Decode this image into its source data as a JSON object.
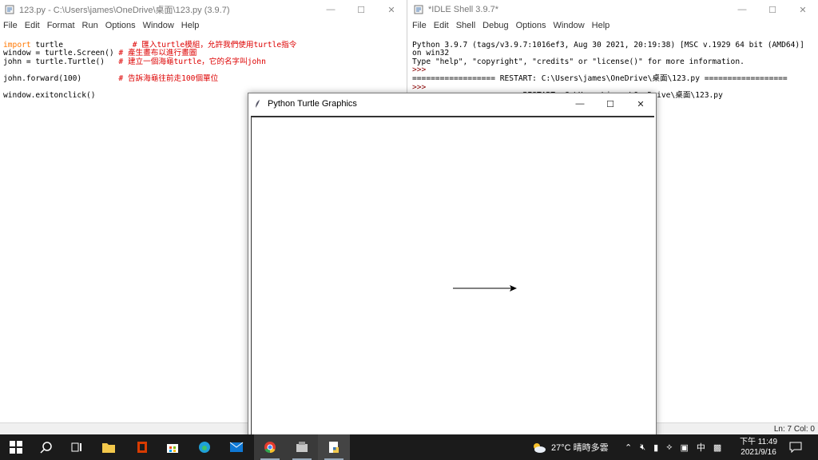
{
  "editor": {
    "title": "123.py - C:\\Users\\james\\OneDrive\\桌面\\123.py (3.9.7)",
    "menu": [
      "File",
      "Edit",
      "Format",
      "Run",
      "Options",
      "Window",
      "Help"
    ],
    "lines": [
      {
        "kw": "import",
        "code": " turtle               ",
        "comment": "# 匯入turtle模組，允許我們使用turtle指令"
      },
      {
        "kw": "",
        "code": "window = turtle.Screen() ",
        "comment": "# 產生畫布以進行畫圖"
      },
      {
        "kw": "",
        "code": "john = turtle.Turtle()   ",
        "comment": "# 建立一個海龜turtle，它的名字叫john"
      },
      {
        "kw": "",
        "code": "",
        "comment": ""
      },
      {
        "kw": "",
        "code": "john.forward(100)        ",
        "comment": "# 告訴海龜往前走100個單位"
      },
      {
        "kw": "",
        "code": "",
        "comment": ""
      },
      {
        "kw": "",
        "code": "window.exitonclick()",
        "comment": ""
      }
    ]
  },
  "shell": {
    "title": "*IDLE Shell 3.9.7*",
    "menu": [
      "File",
      "Edit",
      "Shell",
      "Debug",
      "Options",
      "Window",
      "Help"
    ],
    "line1": "Python 3.9.7 (tags/v3.9.7:1016ef3, Aug 30 2021, 20:19:38) [MSC v.1929 64 bit (AMD64)] on win32",
    "line2": "Type \"help\", \"copyright\", \"credits\" or \"license()\" for more information.",
    "prompt": ">>>",
    "restart1": "================== RESTART: C:\\Users\\james\\OneDrive\\桌面\\123.py ==================",
    "restart2": "======================= RESTART: C:\\Users\\james\\OneDrive\\桌面\\123.py ======================"
  },
  "status": "Ln: 7  Col: 0",
  "turtle_window": {
    "title": "Python Turtle Graphics",
    "drawing": {
      "forward_units": 100
    }
  },
  "taskbar": {
    "weather": "27°C  晴時多雲",
    "ime": "中",
    "time": "下午 11:49",
    "date": "2021/9/16"
  },
  "colors": {
    "keyword": "#ff7700",
    "comment": "#dd0000",
    "taskbar": "#1b1b1b"
  }
}
